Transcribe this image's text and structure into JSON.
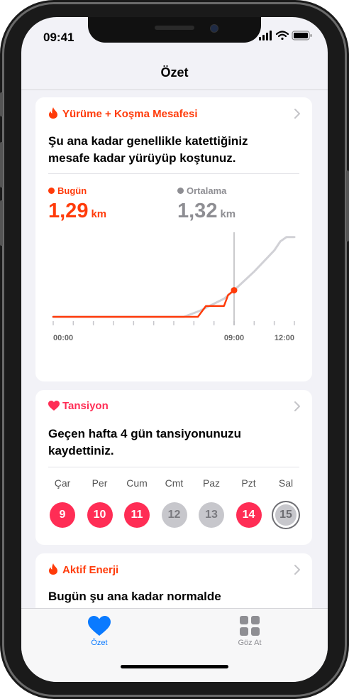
{
  "status": {
    "time": "09:41"
  },
  "nav": {
    "title": "Özet"
  },
  "walk_card": {
    "title": "Yürüme + Koşma Mesafesi",
    "body_line1": "Şu ana kadar genellikle katettiğiniz",
    "body_line2": "mesafe kadar yürüyüp koştunuz.",
    "today_label": "Bugün",
    "today_value": "1,29",
    "today_unit": "km",
    "avg_label": "Ortalama",
    "avg_value": "1,32",
    "avg_unit": "km",
    "colors": {
      "today": "#ff3b0a",
      "avg": "#8e8e93",
      "avg_line": "#d1d1d6"
    }
  },
  "chart_data": {
    "type": "line",
    "x_ticks": [
      "00:00",
      "09:00",
      "12:00"
    ],
    "series": [
      {
        "name": "Bugün",
        "x": [
          0,
          7.0,
          7.2,
          7.6,
          8.5,
          8.7,
          9.0
        ],
        "y": [
          0,
          0,
          0,
          0.18,
          0.18,
          0.36,
          0.44
        ]
      },
      {
        "name": "Ortalama",
        "x": [
          0,
          6.5,
          7.3,
          8.5,
          9.0,
          10.0,
          11.0,
          11.3,
          11.6,
          12.0
        ],
        "y": [
          0,
          0,
          0.1,
          0.3,
          0.44,
          0.75,
          1.1,
          1.25,
          1.32,
          1.32
        ]
      }
    ],
    "xlim": [
      0,
      12
    ],
    "ylim": [
      0,
      1.4
    ]
  },
  "bp_card": {
    "title": "Tansiyon",
    "body_line1": "Geçen hafta 4 gün tansiyonunuzu",
    "body_line2": "kaydettiniz.",
    "days": [
      {
        "name": "Çar",
        "num": "9",
        "recorded": true
      },
      {
        "name": "Per",
        "num": "10",
        "recorded": true
      },
      {
        "name": "Cum",
        "num": "11",
        "recorded": true
      },
      {
        "name": "Cmt",
        "num": "12",
        "recorded": false
      },
      {
        "name": "Paz",
        "num": "13",
        "recorded": false
      },
      {
        "name": "Pzt",
        "num": "14",
        "recorded": true
      },
      {
        "name": "Sal",
        "num": "15",
        "recorded": false,
        "today": true
      }
    ],
    "colors": {
      "accent": "#ff2d55",
      "inactive": "#c7c7cc"
    }
  },
  "energy_card": {
    "title": "Aktif Enerji",
    "body_line1": "Bugün şu ana kadar normalde"
  },
  "tabbar": {
    "summary_label": "Özet",
    "browse_label": "Göz At",
    "active_color": "#0a7aff"
  }
}
